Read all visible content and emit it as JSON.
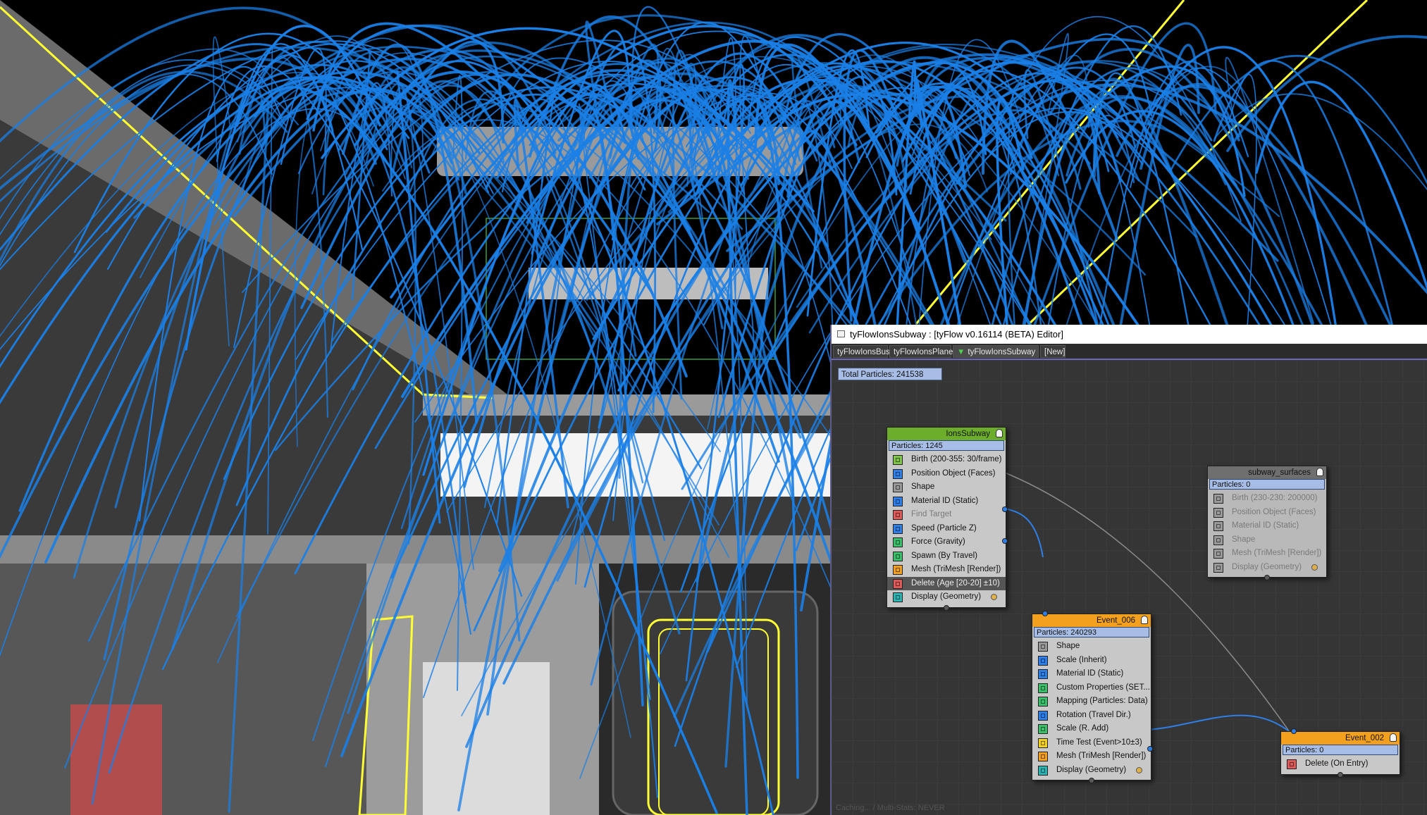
{
  "editor": {
    "title": "tyFlowIonsSubway : [tyFlow v0.16114 (BETA) Editor]",
    "tabs": [
      {
        "label": "tyFlowIonsBus"
      },
      {
        "label": "tyFlowIonsPlane"
      },
      {
        "label": "tyFlowIonsSubway",
        "active": true
      },
      {
        "label": "[New]"
      }
    ],
    "total_particles": "Total Particles: 241538",
    "footer_hint": "Caching... / Multi-Stats: NEVER"
  },
  "colors": {
    "header_green": "#6cae2c",
    "header_orange": "#f2a01e",
    "header_gray": "#6f6f6f",
    "particles_bar": "#a7bde6",
    "wire_blue": "#2e7fe8",
    "highlight_row": "#555555"
  },
  "nodes": [
    {
      "id": "ionsSubway",
      "title": "IonsSubway",
      "particles": "Particles: 1245",
      "header_color": "#6cae2c",
      "operators": [
        {
          "label": "Birth (200-355: 30/frame)",
          "icon": "birth-icon",
          "color": "#7fc64a"
        },
        {
          "label": "Position Object (Faces)",
          "icon": "position-object-icon",
          "color": "#2e7fe8"
        },
        {
          "label": "Shape",
          "icon": "shape-icon",
          "color": "#9a9a9a"
        },
        {
          "label": "Material ID (Static)",
          "icon": "material-id-icon",
          "color": "#2e7fe8"
        },
        {
          "label": "Find Target",
          "icon": "find-target-icon",
          "color": "#e05a5a",
          "disabled": true
        },
        {
          "label": "Speed (Particle Z)",
          "icon": "speed-icon",
          "color": "#2e7fe8"
        },
        {
          "label": "Force (Gravity)",
          "icon": "force-icon",
          "color": "#3bbf6b"
        },
        {
          "label": "Spawn (By Travel)",
          "icon": "spawn-icon",
          "color": "#3bbf6b"
        },
        {
          "label": "Mesh (TriMesh [Render])",
          "icon": "mesh-icon",
          "color": "#f2a01e"
        },
        {
          "label": "Delete (Age [20-20] ±10)",
          "icon": "delete-icon",
          "color": "#e05a5a",
          "highlight": true
        },
        {
          "label": "Display (Geometry)",
          "icon": "display-icon",
          "color": "#2eb3b3",
          "dot": true
        }
      ]
    },
    {
      "id": "event006",
      "title": "Event_006",
      "particles": "Particles: 240293",
      "header_color": "#f2a01e",
      "operators": [
        {
          "label": "Shape",
          "icon": "shape-icon",
          "color": "#9a9a9a"
        },
        {
          "label": "Scale (Inherit)",
          "icon": "scale-icon",
          "color": "#2e7fe8"
        },
        {
          "label": "Material ID (Static)",
          "icon": "material-id-icon",
          "color": "#2e7fe8"
        },
        {
          "label": "Custom Properties (SET...",
          "icon": "custom-properties-icon",
          "color": "#3bbf6b"
        },
        {
          "label": "Mapping (Particles: Data)",
          "icon": "mapping-icon",
          "color": "#3bbf6b"
        },
        {
          "label": "Rotation (Travel Dir.)",
          "icon": "rotation-icon",
          "color": "#2e7fe8"
        },
        {
          "label": "Scale (R. Add)",
          "icon": "scale-icon",
          "color": "#3bbf6b"
        },
        {
          "label": "Time Test (Event>10±3)",
          "icon": "time-test-icon",
          "color": "#f2d21e"
        },
        {
          "label": "Mesh (TriMesh [Render])",
          "icon": "mesh-icon",
          "color": "#f2a01e"
        },
        {
          "label": "Display (Geometry)",
          "icon": "display-icon",
          "color": "#2eb3b3",
          "dot": true
        }
      ]
    },
    {
      "id": "subwaySurfaces",
      "title": "subway_surfaces",
      "particles": "Particles: 0",
      "header_color": "#6f6f6f",
      "disabled": true,
      "operators": [
        {
          "label": "Birth (230-230: 200000)",
          "icon": "birth-icon",
          "color": "#9a9a9a"
        },
        {
          "label": "Position Object (Faces)",
          "icon": "position-object-icon",
          "color": "#9a9a9a"
        },
        {
          "label": "Material ID (Static)",
          "icon": "material-id-icon",
          "color": "#9a9a9a"
        },
        {
          "label": "Shape",
          "icon": "shape-icon",
          "color": "#9a9a9a"
        },
        {
          "label": "Mesh (TriMesh [Render])",
          "icon": "mesh-icon",
          "color": "#9a9a9a"
        },
        {
          "label": "Display (Geometry)",
          "icon": "display-icon",
          "color": "#9a9a9a",
          "dot": true
        }
      ]
    },
    {
      "id": "event002",
      "title": "Event_002",
      "particles": "Particles: 0",
      "header_color": "#f2a01e",
      "operators": [
        {
          "label": "Delete (On Entry)",
          "icon": "delete-icon",
          "color": "#e05a5a"
        }
      ]
    }
  ]
}
